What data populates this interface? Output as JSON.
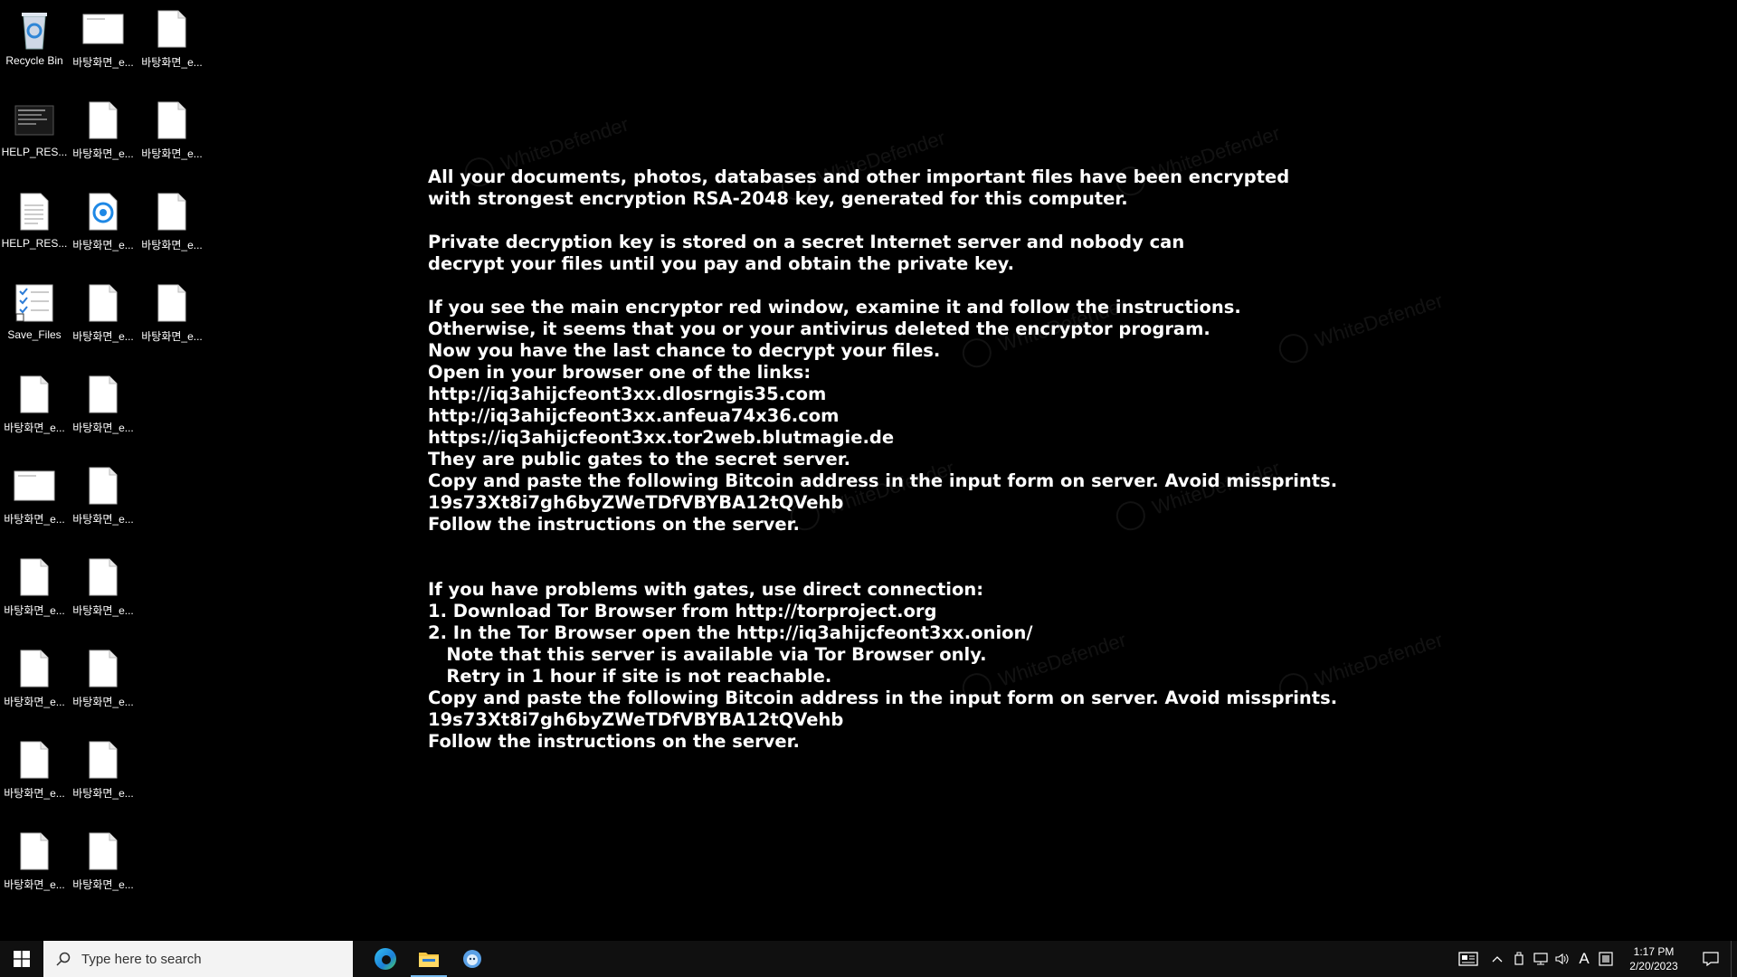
{
  "desktop": {
    "icons": [
      {
        "label": "Recycle Bin",
        "type": "recycle"
      },
      {
        "label": "바탕화면_e...",
        "type": "image"
      },
      {
        "label": "바탕화면_e...",
        "type": "file"
      },
      {
        "label": "HELP_RES...",
        "type": "dark"
      },
      {
        "label": "바탕화면_e...",
        "type": "file"
      },
      {
        "label": "바탕화면_e...",
        "type": "file"
      },
      {
        "label": "HELP_RES...",
        "type": "text"
      },
      {
        "label": "바탕화면_e...",
        "type": "blue"
      },
      {
        "label": "바탕화면_e...",
        "type": "file"
      },
      {
        "label": "Save_Files",
        "type": "checklist"
      },
      {
        "label": "바탕화면_e...",
        "type": "file"
      },
      {
        "label": "바탕화면_e...",
        "type": "file"
      },
      {
        "label": "바탕화면_e...",
        "type": "file"
      },
      {
        "label": "바탕화면_e...",
        "type": "file"
      },
      {
        "label": "바탕화면_e...",
        "type": "image"
      },
      {
        "label": "바탕화면_e...",
        "type": "file"
      },
      {
        "label": "바탕화면_e...",
        "type": "file"
      },
      {
        "label": "바탕화면_e...",
        "type": "file"
      },
      {
        "label": "바탕화면_e...",
        "type": "file"
      },
      {
        "label": "바탕화면_e...",
        "type": "file"
      },
      {
        "label": "바탕화면_e...",
        "type": "file"
      },
      {
        "label": "바탕화면_e...",
        "type": "file"
      },
      {
        "label": "바탕화면_e...",
        "type": "file"
      },
      {
        "label": "바탕화면_e...",
        "type": "file"
      }
    ]
  },
  "note": {
    "lines": [
      "All your documents, photos, databases and other important files have been encrypted",
      "with strongest encryption RSA-2048 key, generated for this computer.",
      "",
      "Private decryption key is stored on a secret Internet server and nobody can",
      "decrypt your files until you pay and obtain the private key.",
      "",
      "If you see the main encryptor red window, examine it and follow the instructions.",
      "Otherwise, it seems that you or your antivirus deleted the encryptor program.",
      "Now you have the last chance to decrypt your files.",
      "Open in your browser one of the links:",
      "http://iq3ahijcfeont3xx.dlosrngis35.com",
      "http://iq3ahijcfeont3xx.anfeua74x36.com",
      "https://iq3ahijcfeont3xx.tor2web.blutmagie.de",
      "They are public gates to the secret server.",
      "Copy and paste the following Bitcoin address in the input form on server. Avoid missprints.",
      "19s73Xt8i7gh6byZWeTDfVBYBA12tQVehb",
      "Follow the instructions on the server.",
      "",
      "",
      "If you have problems with gates, use direct connection:",
      "1. Download Tor Browser from http://torproject.org",
      "2. In the Tor Browser open the http://iq3ahijcfeont3xx.onion/",
      "   Note that this server is available via Tor Browser only.",
      "   Retry in 1 hour if site is not reachable.",
      "Copy and paste the following Bitcoin address in the input form on server. Avoid missprints.",
      "19s73Xt8i7gh6byZWeTDfVBYBA12tQVehb",
      "Follow the instructions on the server."
    ],
    "watermark": "WhiteDefender"
  },
  "taskbar": {
    "search_placeholder": "Type here to search",
    "apps": [
      {
        "name": "edge",
        "active": false
      },
      {
        "name": "file-explorer",
        "active": true
      },
      {
        "name": "app",
        "active": false
      }
    ],
    "tray": {
      "ime": "A",
      "time": "1:17 PM",
      "date": "2/20/2023"
    }
  },
  "colors": {
    "desktop_bg": "#000000",
    "taskbar_bg": "#101010",
    "search_bg": "#f3f3f3",
    "accent": "#76b9ed"
  }
}
